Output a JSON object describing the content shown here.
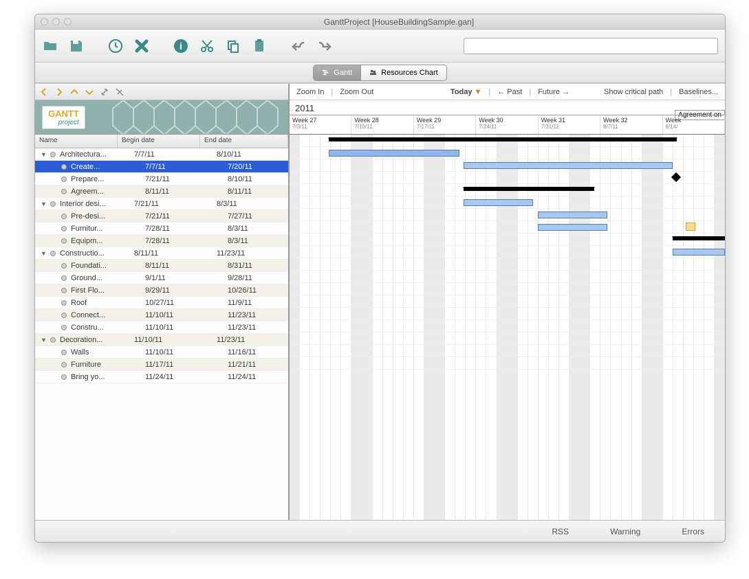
{
  "window": {
    "title": "GanttProject [HouseBuildingSample.gan]"
  },
  "tabs": {
    "gantt": "Gantt",
    "resources": "Resources Chart"
  },
  "left": {
    "columns": {
      "name": "Name",
      "begin": "Begin date",
      "end": "End date"
    },
    "tasks": [
      {
        "name": "Architectura...",
        "begin": "7/7/11",
        "end": "8/10/11",
        "level": 0,
        "group": true
      },
      {
        "name": "Create...",
        "begin": "7/7/11",
        "end": "7/20/11",
        "level": 1,
        "selected": true
      },
      {
        "name": "Prepare...",
        "begin": "7/21/11",
        "end": "8/10/11",
        "level": 1
      },
      {
        "name": "Agreem...",
        "begin": "8/11/11",
        "end": "8/11/11",
        "level": 1
      },
      {
        "name": "Interior desi...",
        "begin": "7/21/11",
        "end": "8/3/11",
        "level": 0,
        "group": true
      },
      {
        "name": "Pre-desi...",
        "begin": "7/21/11",
        "end": "7/27/11",
        "level": 1
      },
      {
        "name": "Furnitur...",
        "begin": "7/28/11",
        "end": "8/3/11",
        "level": 1
      },
      {
        "name": "Equipm...",
        "begin": "7/28/11",
        "end": "8/3/11",
        "level": 1
      },
      {
        "name": "Constructio...",
        "begin": "8/11/11",
        "end": "11/23/11",
        "level": 0,
        "group": true
      },
      {
        "name": "Foundati...",
        "begin": "8/11/11",
        "end": "8/31/11",
        "level": 1
      },
      {
        "name": "Ground...",
        "begin": "9/1/11",
        "end": "9/28/11",
        "level": 1
      },
      {
        "name": "First Flo...",
        "begin": "9/29/11",
        "end": "10/26/11",
        "level": 1
      },
      {
        "name": "Roof",
        "begin": "10/27/11",
        "end": "11/9/11",
        "level": 1
      },
      {
        "name": "Connect...",
        "begin": "11/10/11",
        "end": "11/23/11",
        "level": 1
      },
      {
        "name": "Constru...",
        "begin": "11/10/11",
        "end": "11/23/11",
        "level": 1
      },
      {
        "name": "Decoration...",
        "begin": "11/10/11",
        "end": "11/23/11",
        "level": 0,
        "group": true
      },
      {
        "name": "Walls",
        "begin": "11/10/11",
        "end": "11/16/11",
        "level": 1
      },
      {
        "name": "Furniture",
        "begin": "11/17/11",
        "end": "11/21/11",
        "level": 1
      },
      {
        "name": "Bring yo...",
        "begin": "11/24/11",
        "end": "11/24/11",
        "level": 1
      }
    ]
  },
  "gantt": {
    "zoomin": "Zoom In",
    "zoomout": "Zoom Out",
    "today": "Today",
    "past": "← Past",
    "future": "Future →",
    "critical": "Show critical path",
    "baselines": "Baselines...",
    "year": "2011",
    "milestone_label": "Agreement on",
    "weeks": [
      {
        "label": "Week 27",
        "date": "7/3/11"
      },
      {
        "label": "Week 28",
        "date": "7/10/11"
      },
      {
        "label": "Week 29",
        "date": "7/17/11"
      },
      {
        "label": "Week 30",
        "date": "7/24/11"
      },
      {
        "label": "Week 31",
        "date": "7/31/11"
      },
      {
        "label": "Week 32",
        "date": "8/7/11"
      },
      {
        "label": "Week",
        "date": "8/14/"
      }
    ]
  },
  "status": {
    "rss": "RSS",
    "warning": "Warning",
    "errors": "Errors"
  },
  "chart_data": {
    "type": "gantt",
    "title": "House Building Sample",
    "time_axis": {
      "unit": "week",
      "start": "2011-07-03",
      "weeks": [
        "Week 27",
        "Week 28",
        "Week 29",
        "Week 30",
        "Week 31",
        "Week 32"
      ]
    },
    "tasks": [
      {
        "name": "Architectural design",
        "start": "7/7/11",
        "end": "8/10/11",
        "type": "summary"
      },
      {
        "name": "Create draft",
        "start": "7/7/11",
        "end": "7/20/11",
        "type": "task"
      },
      {
        "name": "Prepare construction docs",
        "start": "7/21/11",
        "end": "8/10/11",
        "type": "task"
      },
      {
        "name": "Agreement",
        "start": "8/11/11",
        "end": "8/11/11",
        "type": "milestone"
      },
      {
        "name": "Interior design",
        "start": "7/21/11",
        "end": "8/3/11",
        "type": "summary"
      },
      {
        "name": "Pre-design",
        "start": "7/21/11",
        "end": "7/27/11",
        "type": "task"
      },
      {
        "name": "Furniture selection",
        "start": "7/28/11",
        "end": "8/3/11",
        "type": "task"
      },
      {
        "name": "Equipment planning",
        "start": "7/28/11",
        "end": "8/3/11",
        "type": "task"
      },
      {
        "name": "Construction phase",
        "start": "8/11/11",
        "end": "11/23/11",
        "type": "summary"
      },
      {
        "name": "Foundation",
        "start": "8/11/11",
        "end": "8/31/11",
        "type": "task"
      }
    ]
  }
}
